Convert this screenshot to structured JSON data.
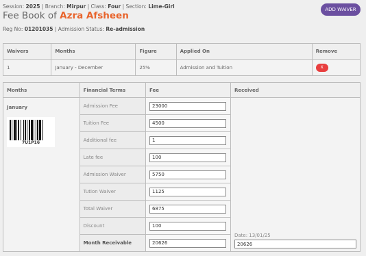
{
  "header": {
    "session_label": "Session:",
    "session": "2025",
    "branch_label": "| Branch:",
    "branch": "Mirpur",
    "class_label": "| Class:",
    "class": "Four",
    "section_label": "| Section:",
    "section": "Lime-Girl",
    "title_prefix": "Fee Book of",
    "student_name": "Azra Afsheen",
    "reg_label": "Reg No:",
    "reg_no": "01201035",
    "status_label": "| Admission Status:",
    "status": "Re-admission",
    "add_waiver_label": "ADD WAIVER"
  },
  "waivers": {
    "columns": [
      "Waivers",
      "Months",
      "Figure",
      "Applied On",
      "Remove"
    ],
    "rows": [
      {
        "waivers": "1",
        "months": "January - December",
        "figure": "25%",
        "applied_on": "Admission and Tuition",
        "remove_label": "X"
      }
    ]
  },
  "fee_table": {
    "columns": [
      "Months",
      "Financial Terms",
      "Fee",
      "Received"
    ],
    "month": "January",
    "barcode_text": "7ᑌ1ᑭ16",
    "terms": [
      {
        "label": "Admission Fee",
        "value": "23000"
      },
      {
        "label": "Tuition Fee",
        "value": "4500"
      },
      {
        "label": "Additional fee",
        "value": "1"
      },
      {
        "label": "Late fee",
        "value": "100"
      },
      {
        "label": "Admission Waiver",
        "value": "5750"
      },
      {
        "label": "Tution Waiver",
        "value": "1125"
      },
      {
        "label": "Total Waiver",
        "value": "6875"
      },
      {
        "label": "Discount",
        "value": "100"
      },
      {
        "label": "Month Receivable",
        "value": "20626"
      }
    ],
    "received_date": "Date: 13/01/25",
    "received_value": "20626"
  },
  "colors": {
    "accent": "#6b4fa0",
    "name": "#e8642c",
    "remove": "#e83e3e"
  }
}
